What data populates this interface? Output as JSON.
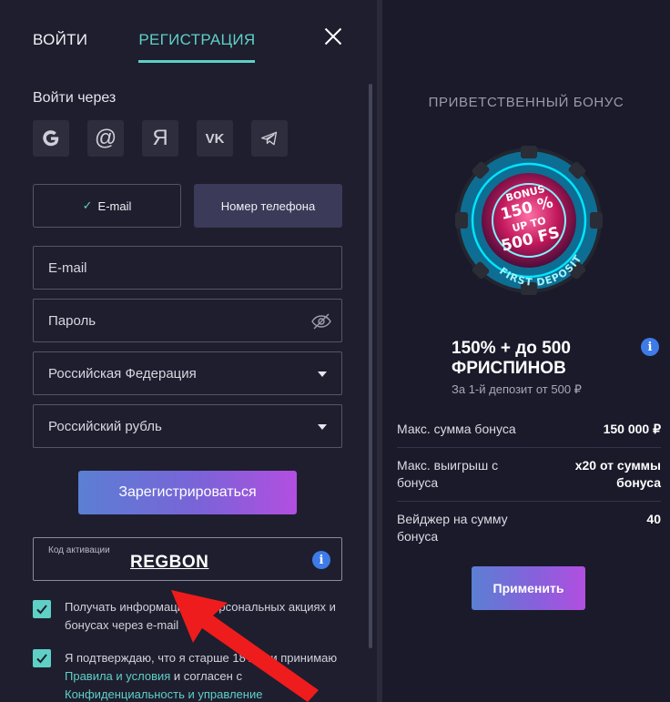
{
  "auth": {
    "tab_login": "ВОЙТИ",
    "tab_register": "РЕГИСТРАЦИЯ",
    "login_via": "Войти через",
    "socials": [
      {
        "icon": "google-icon",
        "glyph": "G"
      },
      {
        "icon": "mail-at-icon",
        "glyph": "@"
      },
      {
        "icon": "yandex-icon",
        "glyph": "Я"
      },
      {
        "icon": "vk-icon",
        "glyph": "VK"
      },
      {
        "icon": "telegram-icon",
        "glyph": ""
      }
    ],
    "method_email": "E-mail",
    "method_phone": "Номер телефона",
    "email_placeholder": "E-mail",
    "password_placeholder": "Пароль",
    "country": "Российская Федерация",
    "currency": "Российский рубль",
    "register_button": "Зарегистрироваться",
    "promo_label": "Код активации",
    "promo_value": "REGBON",
    "checkbox1_text": "Получать информацию о персональных акциях и бонусах через e-mail",
    "checkbox2_text": "Я подтверждаю, что я старше 18 лет и принимаю",
    "checkbox2_link1": "Правила и условия",
    "checkbox2_mid": " и согласен с",
    "checkbox2_link2": "Конфиденциальность и управление"
  },
  "bonus": {
    "title": "ПРИВЕТСТВЕННЫЙ БОНУС",
    "chip": {
      "line1": "BONUS",
      "line2": "150 %",
      "line3": "UP TO",
      "line4": "500 FS",
      "ring": "FIRST DEPOSIT"
    },
    "offer_line1": "150% + до 500",
    "offer_line2": "ФРИСПИНОВ",
    "deposit_text": "За 1-й депозит от 500 ₽",
    "rows": [
      {
        "key": "Макс. сумма бонуса",
        "value": "150 000 ₽"
      },
      {
        "key": "Макс. выигрыш с бонуса",
        "value": "x20 от суммы бонуса"
      },
      {
        "key": "Вейджер на сумму бонуса",
        "value": "40"
      }
    ],
    "apply_button": "Применить"
  },
  "colors": {
    "accent": "#5fd0c6",
    "info": "#3e7be8",
    "annotation_arrow": "#ee1c1c"
  }
}
